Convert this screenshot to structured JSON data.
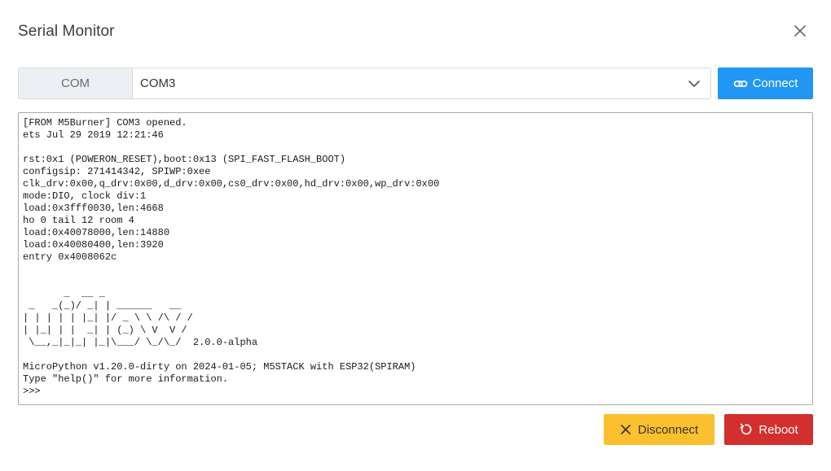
{
  "dialog": {
    "title": "Serial Monitor",
    "close_icon": "close-icon"
  },
  "port": {
    "label": "COM",
    "selected": "COM3",
    "dropdown_icon": "chevron-down-icon"
  },
  "buttons": {
    "connect": "Connect",
    "connect_icon": "link-icon",
    "disconnect": "Disconnect",
    "disconnect_icon": "close-icon",
    "reboot": "Reboot",
    "reboot_icon": "refresh-icon"
  },
  "terminal": {
    "output": "[FROM M5Burner] COM3 opened.\nets Jul 29 2019 12:21:46\n\nrst:0x1 (POWERON_RESET),boot:0x13 (SPI_FAST_FLASH_BOOT)\nconfigsip: 271414342, SPIWP:0xee\nclk_drv:0x00,q_drv:0x00,d_drv:0x00,cs0_drv:0x00,hd_drv:0x00,wp_drv:0x00\nmode:DIO, clock div:1\nload:0x3fff0030,len:4668\nho 0 tail 12 room 4\nload:0x40078000,len:14880\nload:0x40080400,len:3920\nentry 0x4008062c\n\n\n       _  __ _\n _   _(_)/ _| | ______   __\n| | | | | |_| |/ _ \\ \\ /\\ / /\n| |_| | |  _| | (_) \\ V  V /\n \\__,_|_|_| |_|\\___/ \\_/\\_/  2.0.0-alpha\n\nMicroPython v1.20.0-dirty on 2024-01-05; M5STACK with ESP32(SPIRAM)\nType \"help()\" for more information.\n>>>"
  },
  "colors": {
    "connect": "#2196f3",
    "disconnect": "#fbc02d",
    "reboot": "#d32f2f"
  }
}
